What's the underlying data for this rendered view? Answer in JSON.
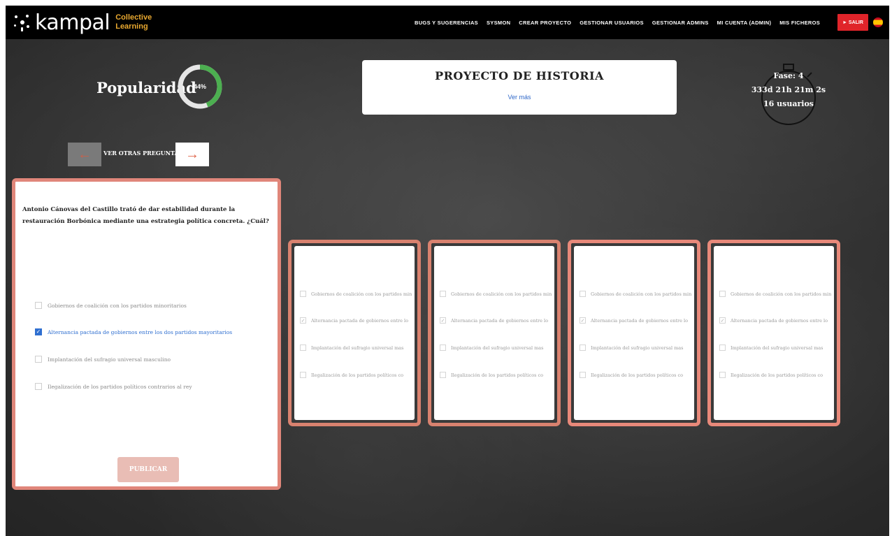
{
  "brand": {
    "name": "kampal",
    "sub_line1": "Collective",
    "sub_line2": "Learning"
  },
  "nav": {
    "items": [
      "BUGS Y SUGERENCIAS",
      "SYSMON",
      "CREAR PROYECTO",
      "GESTIONAR USUARIOS",
      "GESTIONAR ADMINS",
      "MI CUENTA (ADMIN)",
      "MIS FICHEROS"
    ],
    "logout_label": "► SALIR"
  },
  "popularity": {
    "label": "Popularidad",
    "value_text": "44%",
    "fraction": 0.44,
    "ring_color": "#4caf50",
    "ring_bg_color": "#e6e6e6"
  },
  "project": {
    "title": "PROYECTO DE HISTORIA",
    "link": "Ver más"
  },
  "timer": {
    "phase": "Fase: 4",
    "time": "333d 21h 21m 2s",
    "users": "16 usuarios"
  },
  "question_nav": {
    "prev_icon": "left-arrow-icon",
    "next_icon": "right-arrow-icon",
    "label": "VER OTRAS PREGUNTAS"
  },
  "question": {
    "text": "Antonio Cánovas del Castillo trató de dar estabilidad durante la restauración Borbónica mediante una estrategia política concreta. ¿Cuál?",
    "options": [
      {
        "label": "Gobiernos de coalición con los partidos minoritarios",
        "checked": false
      },
      {
        "label": "Alternancia pactada de gobiernos entre los dos partidos mayoritarios",
        "checked": true
      },
      {
        "label": "Implantación del sufragio universal masculino",
        "checked": false
      },
      {
        "label": "Ilegalización de los partidos políticos contrarios al rey",
        "checked": false
      }
    ],
    "publish_label": "PUBLICAR"
  },
  "answer_cards": [
    {
      "options": [
        "Gobiernos de coalición con los partidos min",
        "Alternancia pactada de gobiernos entre lo",
        "Implantación del sufragio universal mas",
        "Ilegalización de los partidos políticos co"
      ],
      "checked": 1
    },
    {
      "options": [
        "Gobiernos de coalición con los partidos min",
        "Alternancia pactada de gobiernos entre lo",
        "Implantación del sufragio universal mas",
        "Ilegalización de los partidos políticos co"
      ],
      "checked": 1
    },
    {
      "options": [
        "Gobiernos de coalición con los partidos min",
        "Alternancia pactada de gobiernos entre lo",
        "Implantación del sufragio universal mas",
        "Ilegalización de los partidos políticos co"
      ],
      "checked": 1
    },
    {
      "options": [
        "Gobiernos de coalición con los partidos min",
        "Alternancia pactada de gobiernos entre lo",
        "Implantación del sufragio universal mas",
        "Ilegalización de los partidos políticos co"
      ],
      "checked": 1
    }
  ],
  "colors": {
    "card_border": "#e0867a",
    "accent_blue": "#2f6fd0",
    "logout_red": "#e0242a",
    "brand_orange": "#e8a830"
  }
}
